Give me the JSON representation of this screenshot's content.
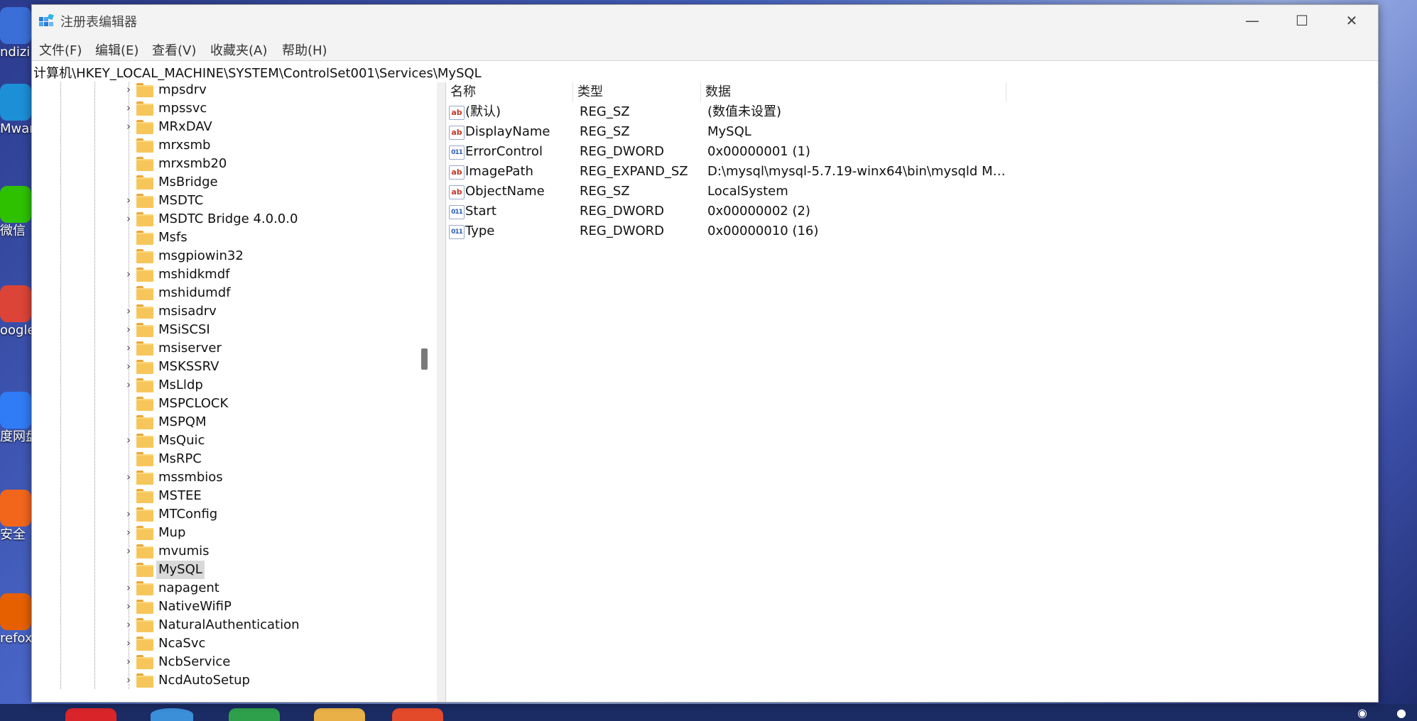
{
  "window": {
    "title": "注册表编辑器",
    "minimize_glyph": "—",
    "maximize_glyph": "☐",
    "close_glyph": "✕"
  },
  "menu": [
    "文件(F)",
    "编辑(E)",
    "查看(V)",
    "收藏夹(A)",
    "帮助(H)"
  ],
  "address": "计算机\\HKEY_LOCAL_MACHINE\\SYSTEM\\ControlSet001\\Services\\MySQL",
  "tree": {
    "items": [
      {
        "label": "mpsdrv",
        "expandable": true
      },
      {
        "label": "mpssvc",
        "expandable": true
      },
      {
        "label": "MRxDAV",
        "expandable": true
      },
      {
        "label": "mrxsmb",
        "expandable": false
      },
      {
        "label": "mrxsmb20",
        "expandable": false
      },
      {
        "label": "MsBridge",
        "expandable": false
      },
      {
        "label": "MSDTC",
        "expandable": true
      },
      {
        "label": "MSDTC Bridge 4.0.0.0",
        "expandable": true
      },
      {
        "label": "Msfs",
        "expandable": false
      },
      {
        "label": "msgpiowin32",
        "expandable": false
      },
      {
        "label": "mshidkmdf",
        "expandable": true
      },
      {
        "label": "mshidumdf",
        "expandable": false
      },
      {
        "label": "msisadrv",
        "expandable": true
      },
      {
        "label": "MSiSCSI",
        "expandable": true
      },
      {
        "label": "msiserver",
        "expandable": true
      },
      {
        "label": "MSKSSRV",
        "expandable": true
      },
      {
        "label": "MsLldp",
        "expandable": true
      },
      {
        "label": "MSPCLOCK",
        "expandable": false
      },
      {
        "label": "MSPQM",
        "expandable": false
      },
      {
        "label": "MsQuic",
        "expandable": true
      },
      {
        "label": "MsRPC",
        "expandable": false
      },
      {
        "label": "mssmbios",
        "expandable": true
      },
      {
        "label": "MSTEE",
        "expandable": false
      },
      {
        "label": "MTConfig",
        "expandable": true
      },
      {
        "label": "Mup",
        "expandable": true
      },
      {
        "label": "mvumis",
        "expandable": true
      },
      {
        "label": "MySQL",
        "expandable": false,
        "selected": true
      },
      {
        "label": "napagent",
        "expandable": true
      },
      {
        "label": "NativeWifiP",
        "expandable": true
      },
      {
        "label": "NaturalAuthentication",
        "expandable": true
      },
      {
        "label": "NcaSvc",
        "expandable": true
      },
      {
        "label": "NcbService",
        "expandable": true
      },
      {
        "label": "NcdAutoSetup",
        "expandable": true
      }
    ]
  },
  "list": {
    "columns": [
      "名称",
      "类型",
      "数据"
    ],
    "rows": [
      {
        "icon": "string-value-icon",
        "name": "(默认)",
        "type": "REG_SZ",
        "data": "(数值未设置)"
      },
      {
        "icon": "string-value-icon",
        "name": "DisplayName",
        "type": "REG_SZ",
        "data": "MySQL"
      },
      {
        "icon": "binary-value-icon",
        "name": "ErrorControl",
        "type": "REG_DWORD",
        "data": "0x00000001 (1)"
      },
      {
        "icon": "string-value-icon",
        "name": "ImagePath",
        "type": "REG_EXPAND_SZ",
        "data": "D:\\mysql\\mysql-5.7.19-winx64\\bin\\mysqld My..."
      },
      {
        "icon": "string-value-icon",
        "name": "ObjectName",
        "type": "REG_SZ",
        "data": "LocalSystem"
      },
      {
        "icon": "binary-value-icon",
        "name": "Start",
        "type": "REG_DWORD",
        "data": "0x00000002 (2)"
      },
      {
        "icon": "binary-value-icon",
        "name": "Type",
        "type": "REG_DWORD",
        "data": "0x00000010 (16)"
      }
    ]
  },
  "desktop": {
    "icons": [
      {
        "label": "ndizi",
        "color": "#3a6fd8"
      },
      {
        "label": "Mware",
        "color": "#1c8fd6"
      },
      {
        "label": "微信",
        "color": "#2dc100"
      },
      {
        "label": "oogle",
        "color": "#db4437"
      },
      {
        "label": "度网盘",
        "color": "#2f7cf6"
      },
      {
        "label": "安全",
        "color": "#f2661b"
      },
      {
        "label": "refox",
        "color": "#e66000"
      }
    ]
  },
  "value_icons": {
    "string": "ab",
    "binary": "011\n110"
  }
}
